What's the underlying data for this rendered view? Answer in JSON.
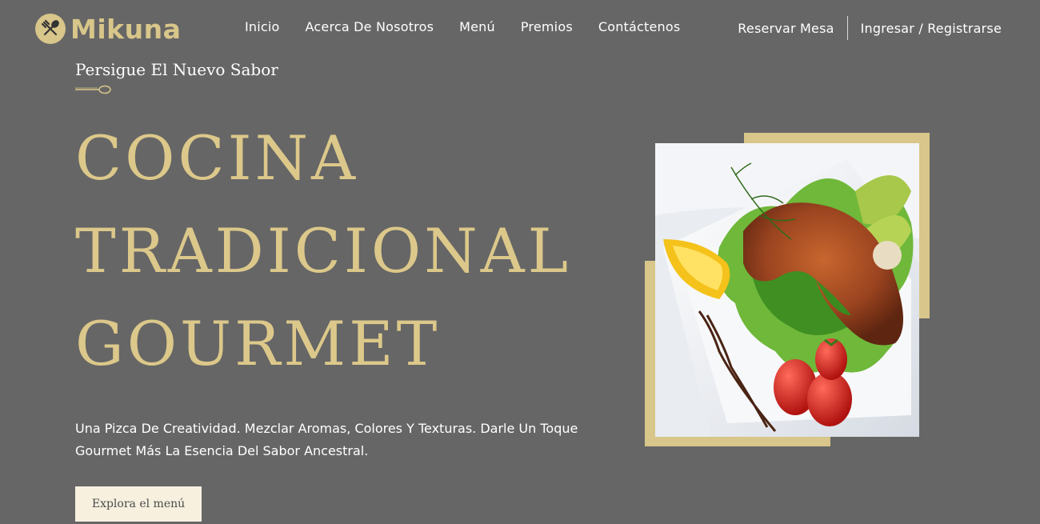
{
  "brand": {
    "name": "Mikuna"
  },
  "nav": {
    "items": [
      {
        "label": "Inicio"
      },
      {
        "label": "Acerca De Nosotros"
      },
      {
        "label": "Menú"
      },
      {
        "label": "Premios"
      },
      {
        "label": "Contáctenos"
      }
    ],
    "reserve_label": "Reservar Mesa",
    "login_label": "Ingresar / Registrarse"
  },
  "hero": {
    "tagline": "Persigue El Nuevo Sabor",
    "headline_lines": [
      "COCINA",
      "TRADICIONAL",
      "GOURMET"
    ],
    "description_line1": "Una Pizca De Creatividad. Mezclar Aromas, Colores Y Texturas. Darle Un Toque",
    "description_line2": "Gourmet Más La Esencia Del Sabor Ancestral.",
    "cta_label": "Explora el menú"
  },
  "colors": {
    "background": "#666666",
    "accent_gold": "#d8c68a",
    "button_bg": "#f7f0df"
  },
  "icons": {
    "logo": "fork-spoon-icon",
    "divider": "spoon-divider-icon"
  }
}
